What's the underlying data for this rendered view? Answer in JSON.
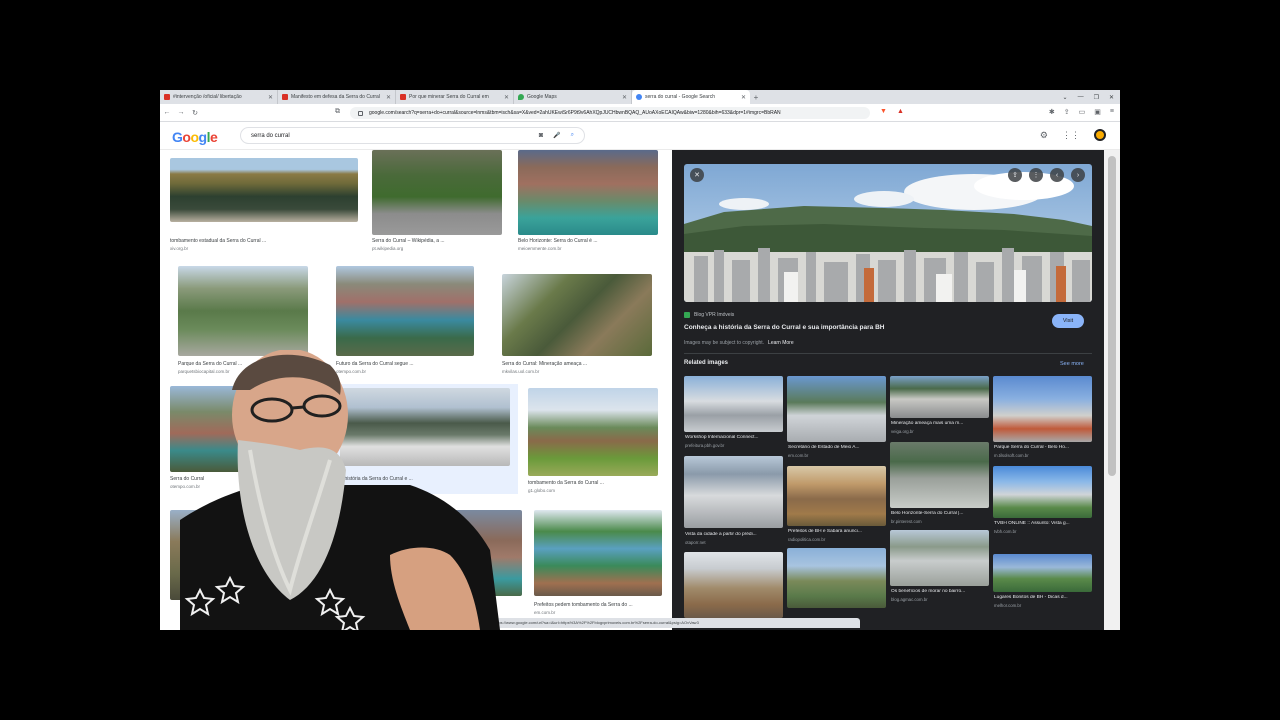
{
  "browser": {
    "tabs": [
      {
        "label": "#intervenção /oficial/ libertação",
        "color": "#d93025"
      },
      {
        "label": "Manifesto em defesa da Serra do Curral",
        "color": "#d93025"
      },
      {
        "label": "Por que minerar Serra do Curral em",
        "color": "#d93025"
      },
      {
        "label": "Google Maps",
        "color": "#34a853"
      },
      {
        "label": "serra do curral - Google Search",
        "color": "#4285f4"
      }
    ],
    "url": "google.com/search?q=serra+do+curral&source=lnms&tbm=isch&sa=X&ved=2ahUKEwiSr6P9t9v6AhXQpJUCHbwnBQAQ_AUoAXoECAIQAw&biw=1280&bih=633&dpr=1#imgrc=BbRAN"
  },
  "google": {
    "logo": "Google",
    "query": "serra do curral"
  },
  "results": [
    {
      "caption": "tombamento estadual da Serra do Curral ...",
      "source": "xiv.org.br"
    },
    {
      "caption": "Serra do Curral – Wikipédia, a ...",
      "source": "pt.wikipedia.org"
    },
    {
      "caption": "Belo Horizonte: Serra do Curral é ...",
      "source": "meioemmente.com.br"
    },
    {
      "caption": "Parque da Serra do Curral ...",
      "source": "parquetsbiocapital.com.br"
    },
    {
      "caption": "Futuro da Serra do Curral segue ...",
      "source": "otempo.com.br"
    },
    {
      "caption": "Serra do Curral: Mineração ameaça ...",
      "source": "mkvilas.uol.com.br"
    },
    {
      "caption": "Serra do Curral",
      "source": "otempo.com.br"
    },
    {
      "caption": "A história da Serra do Curral e ...",
      "source": ""
    },
    {
      "caption": "tombamento da Serra do Curral ...",
      "source": "g1.globo.com"
    },
    {
      "caption": "",
      "source": ""
    },
    {
      "caption": "",
      "source": ""
    },
    {
      "caption": "Prefeitos pedem tombamento da Serra do ...",
      "source": "em.com.br"
    }
  ],
  "panel": {
    "source": "Blog VPR Imóveis",
    "title": "Conheça a história da Serra do Curral e sua importância para BH",
    "copyright": "Images may be subject to copyright.",
    "learn_more": "Learn More",
    "visit": "Visit",
    "related_heading": "Related images",
    "see_more": "See more",
    "related": [
      {
        "caption": "Workshop Internacional Connect...",
        "source": "prefeitura.pbh.gov.br"
      },
      {
        "caption": "Secretário de Estado de Meio A...",
        "source": "em.com.br"
      },
      {
        "caption": "Mineração ameaça mais uma m...",
        "source": "veiga.org.br"
      },
      {
        "caption": "Parque Serra do Curral - Belo Ho...",
        "source": "m.tilsolsoft.com.br"
      },
      {
        "caption": "Vista da cidade a partir do prédi...",
        "source": "otaporr.net"
      },
      {
        "caption": "Prefeitos de BH e Sabará anunci...",
        "source": "radiopolitica.com.br"
      },
      {
        "caption": "Belo Horizonte-Serra do Curral |...",
        "source": "br.pinterest.com"
      },
      {
        "caption": "TVBH ONLINE :: Assunto: Vista g...",
        "source": "tvbh.com.br"
      },
      {
        "caption": "",
        "source": ""
      },
      {
        "caption": "",
        "source": ""
      },
      {
        "caption": "Os benefícios de morar no bairro...",
        "source": "blog.agmac.com.br"
      },
      {
        "caption": "Lugares Bonitos de BH - Dicas d...",
        "source": "melhor.com.br"
      }
    ]
  },
  "status_url": "https://www.google.com/url?sa=i&url=https%3A%2F%2Fblogvprimoveis.com.br%2Fserra-do-curral&psig=AOvVaw3"
}
